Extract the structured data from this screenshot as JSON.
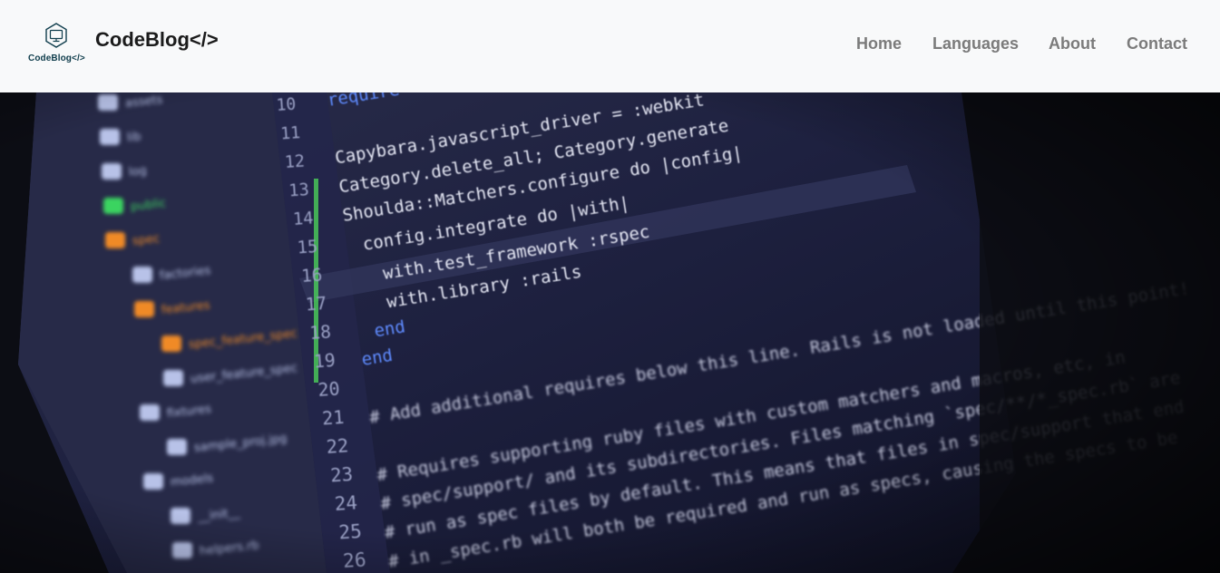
{
  "brand": {
    "name": "CodeBlog</>",
    "logo_text": "CodeBlog</>"
  },
  "nav": {
    "items": [
      "Home",
      "Languages",
      "About",
      "Contact"
    ]
  },
  "hero": {
    "line_numbers": [
      "10",
      "11",
      "12",
      "13",
      "14",
      "15",
      "16",
      "17",
      "18",
      "19",
      "20",
      "21",
      "22",
      "23",
      "24",
      "25",
      "26"
    ],
    "code_lines": [
      "require 'capybara/rails'",
      "",
      "Capybara.javascript_driver = :webkit",
      "Category.delete_all; Category.generate",
      "Shoulda::Matchers.configure do |config|",
      "  config.integrate do |with|",
      "    with.test_framework :rspec",
      "    with.library :rails",
      "  end",
      "end",
      "",
      "# Add additional requires below this line. Rails is not loaded until this point!",
      "",
      "# Requires supporting ruby files with custom matchers and macros, etc, in",
      "# spec/support/ and its subdirectories. Files matching `spec/**/*_spec.rb` are",
      "# run as spec files by default. This means that files in spec/support that end",
      "# in _spec.rb will both be required and run as specs, causing the specs to be"
    ],
    "file_tree": [
      "assets",
      "lib",
      "log",
      "public",
      "spec",
      "factories",
      "features",
      "spec_feature_spec",
      "user_feature_spec",
      "fixtures",
      "sample_proj.jpg",
      "models",
      "__init__",
      "helpers.rb"
    ],
    "colors": {
      "code": "#e6e8f5",
      "keyword": "#5f8bff",
      "symbol": "#9ff09a",
      "comment": "#c8cbe0",
      "linenum": "#9aa0c4",
      "folder_active": "#f08a25",
      "folder": "#b8c2e8"
    }
  }
}
